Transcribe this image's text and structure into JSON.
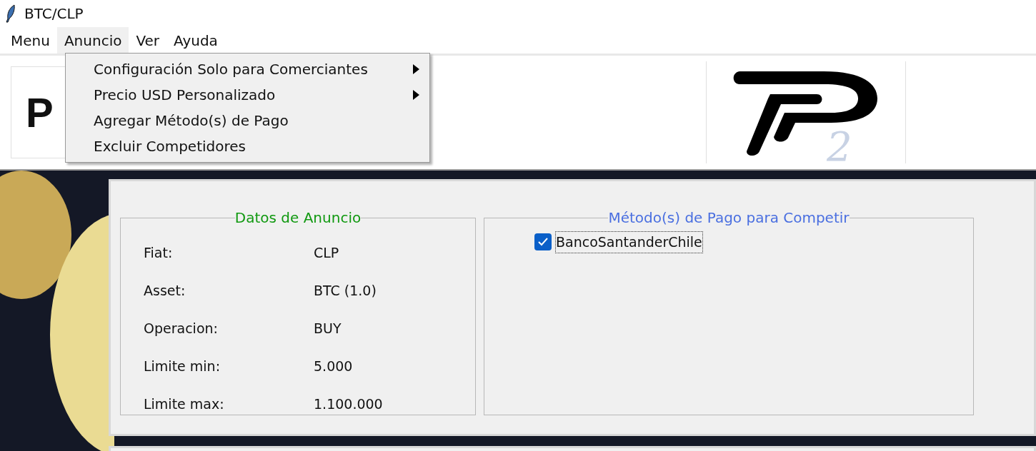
{
  "window": {
    "title": "BTC/CLP"
  },
  "menu_bar": [
    {
      "label": "Menu",
      "selected": false
    },
    {
      "label": "Anuncio",
      "selected": true
    },
    {
      "label": "Ver",
      "selected": false
    },
    {
      "label": "Ayuda",
      "selected": false
    }
  ],
  "dropdown": [
    {
      "label": "Configuración Solo para Comerciantes",
      "submenu": true
    },
    {
      "label": "Precio USD Personalizado",
      "submenu": true
    },
    {
      "label": "Agregar Método(s) de Pago",
      "submenu": false
    },
    {
      "label": "Excluir Competidores",
      "submenu": false
    }
  ],
  "logos": {
    "left_text": "P",
    "right_text": "2"
  },
  "ad_data": {
    "title": "Datos de Anuncio",
    "rows": [
      {
        "label": "Fiat:",
        "value": "CLP"
      },
      {
        "label": "Asset:",
        "value": "BTC (1.0)"
      },
      {
        "label": "Operacion:",
        "value": "BUY"
      },
      {
        "label": "Limite min:",
        "value": "5.000"
      },
      {
        "label": "Limite max:",
        "value": "1.100.000"
      }
    ]
  },
  "payment_methods": {
    "title": "Método(s) de Pago para Competir",
    "items": [
      {
        "label": "BancoSantanderChile",
        "checked": true,
        "focused": true
      }
    ]
  }
}
